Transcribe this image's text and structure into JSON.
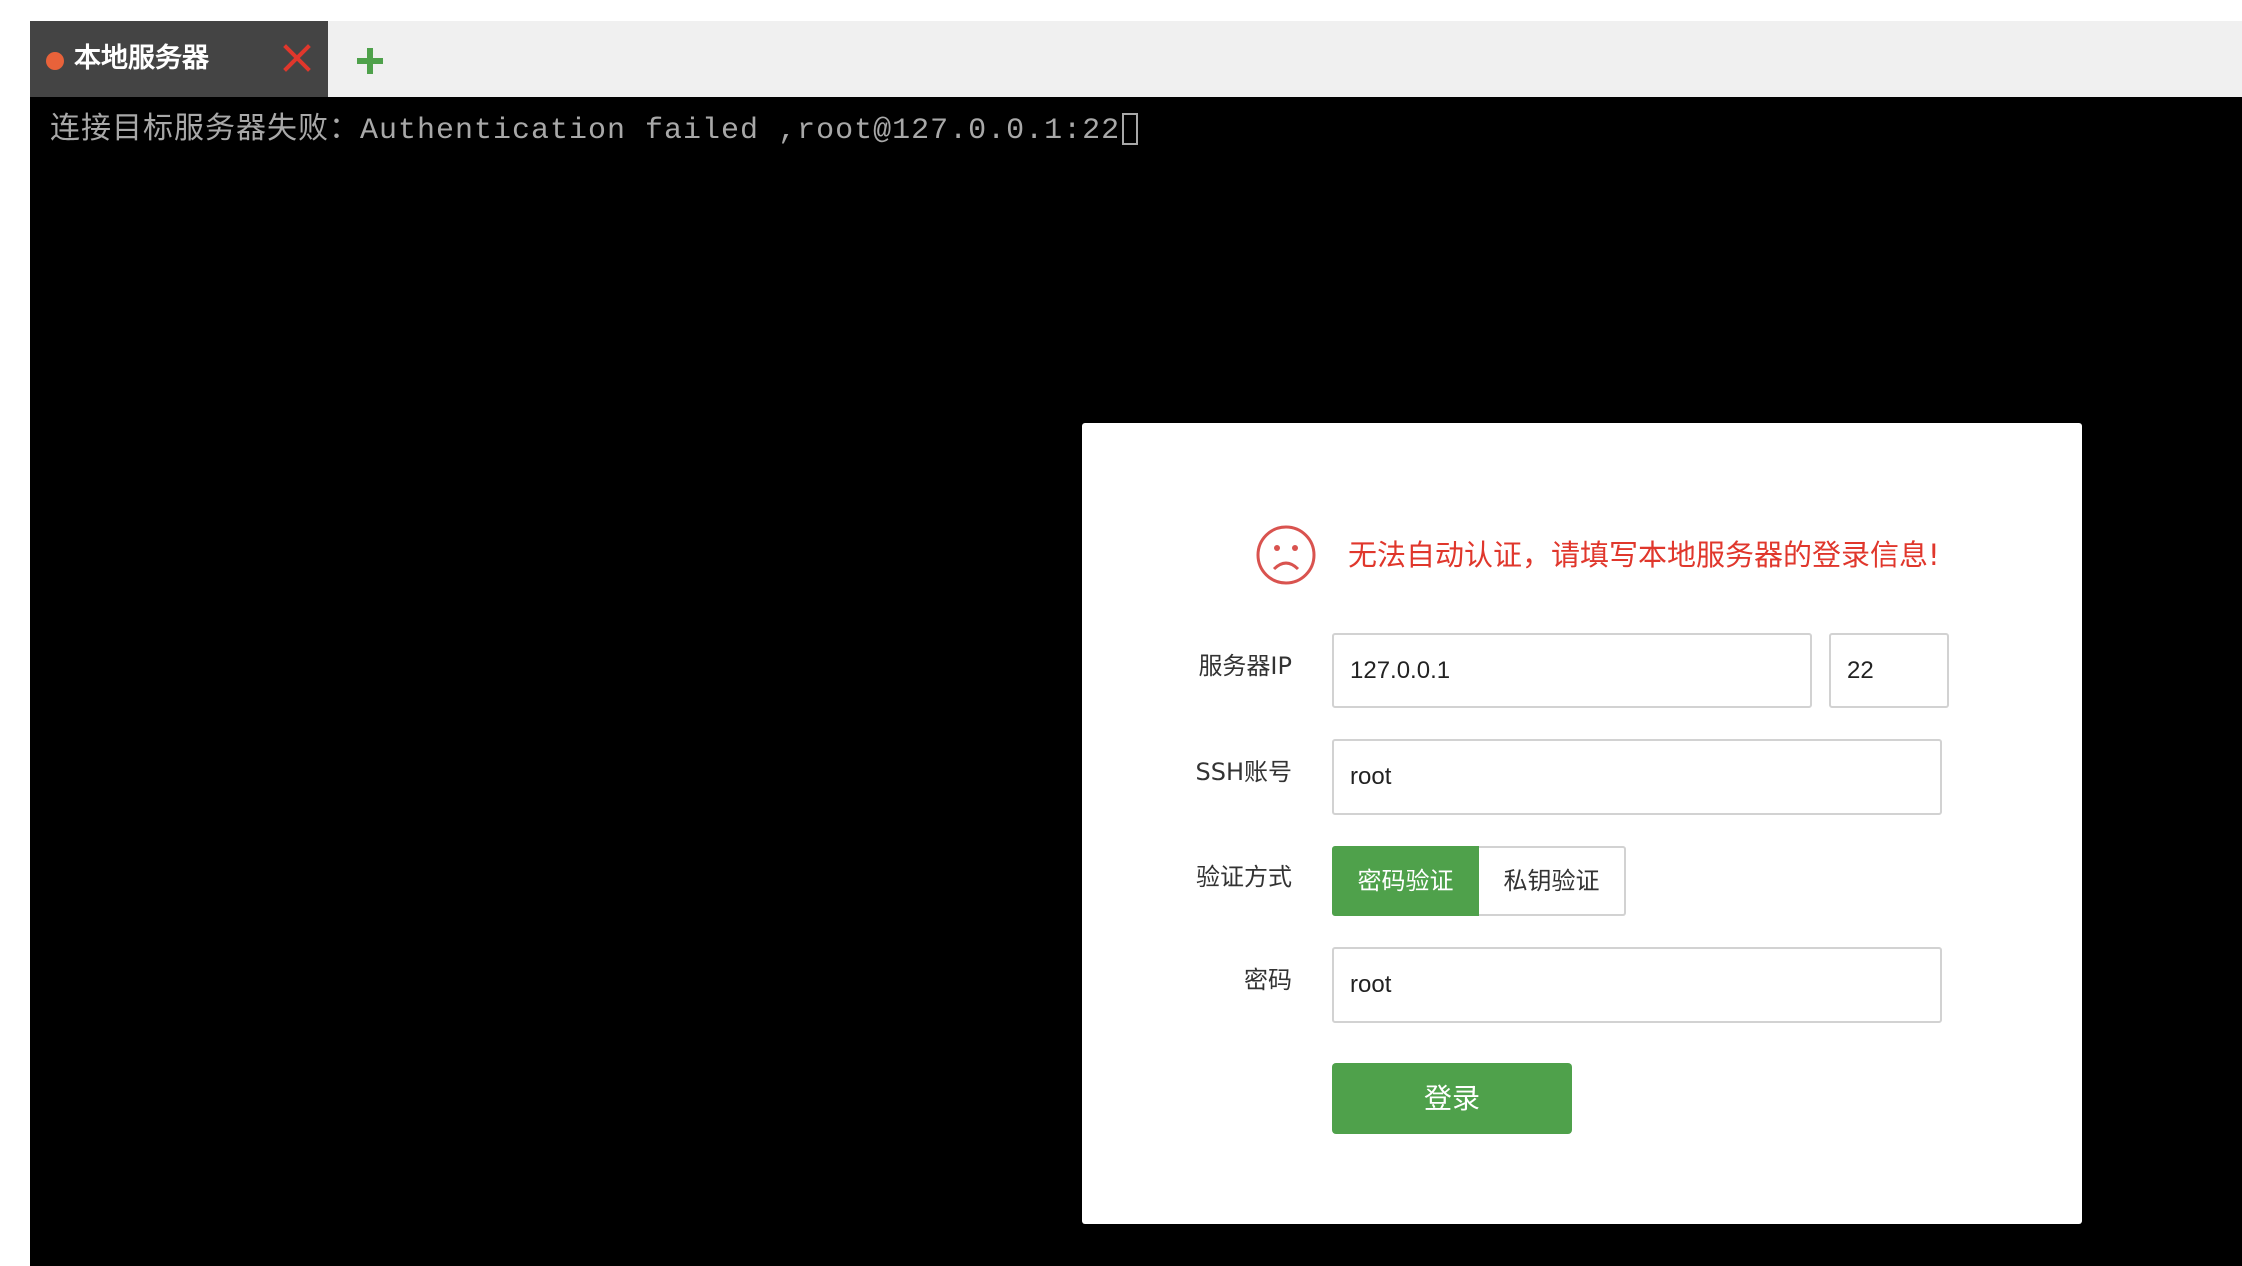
{
  "tabs": [
    {
      "label": "本地服务器",
      "status_color": "#e8623a",
      "active": true
    }
  ],
  "tab_close_icon": "close-icon",
  "add_tab_icon": "plus-icon",
  "terminal": {
    "line": "连接目标服务器失败：Authentication failed ,root@127.0.0.1:22"
  },
  "dialog": {
    "icon": "sad-face-icon",
    "message": "无法自动认证，请填写本地服务器的登录信息!",
    "server_ip_label": "服务器IP",
    "server_ip_value": "127.0.0.1",
    "port_value": "22",
    "ssh_account_label": "SSH账号",
    "ssh_account_value": "root",
    "auth_method_label": "验证方式",
    "auth_options": [
      "密码验证",
      "私钥验证"
    ],
    "auth_selected": "密码验证",
    "password_label": "密码",
    "password_value": "root",
    "login_label": "登录"
  },
  "colors": {
    "accent_green": "#4fa14b",
    "error_red": "#e0372c",
    "tab_dark": "#444444"
  }
}
